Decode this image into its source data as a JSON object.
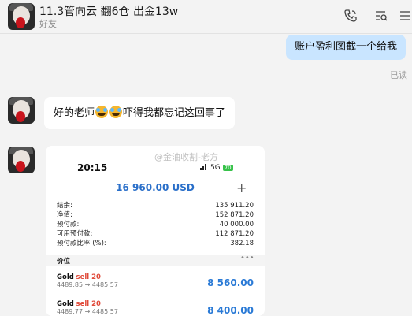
{
  "header": {
    "name": "11.3管向云      翻6仓 出金13w",
    "subtitle": "好友"
  },
  "messages": {
    "outgoing_text": "账户盈利图截一个给我",
    "read_status": "已读",
    "incoming_text_1": "好的老师",
    "incoming_text_2": "吓得我都忘记这回事了"
  },
  "screenshot": {
    "time": "20:15",
    "network": "5G",
    "battery": "70",
    "watermark": "@金油收割-老方",
    "balance": "16 960.00 USD",
    "plus": "+",
    "stats": [
      {
        "label": "结余:",
        "value": "135 911.20"
      },
      {
        "label": "净值:",
        "value": "152 871.20"
      },
      {
        "label": "预付款:",
        "value": "40 000.00"
      },
      {
        "label": "可用预付款:",
        "value": "112 871.20"
      },
      {
        "label": "预付款比率 (%):",
        "value": "382.18"
      }
    ],
    "price_section": "价位",
    "dots": "•••",
    "positions": [
      {
        "symbol": "Gold",
        "side": "sell 20",
        "prices": "4489.85 → 4485.57",
        "profit": "8 560.00"
      },
      {
        "symbol": "Gold",
        "side": "sell 20",
        "prices": "4489.77 → 4485.57",
        "profit": "8 400.00"
      }
    ]
  },
  "colors": {
    "outgoing_bubble": "#c9e5ff",
    "profit_blue": "#2a7ad6",
    "sell_red": "#e04a3a"
  }
}
